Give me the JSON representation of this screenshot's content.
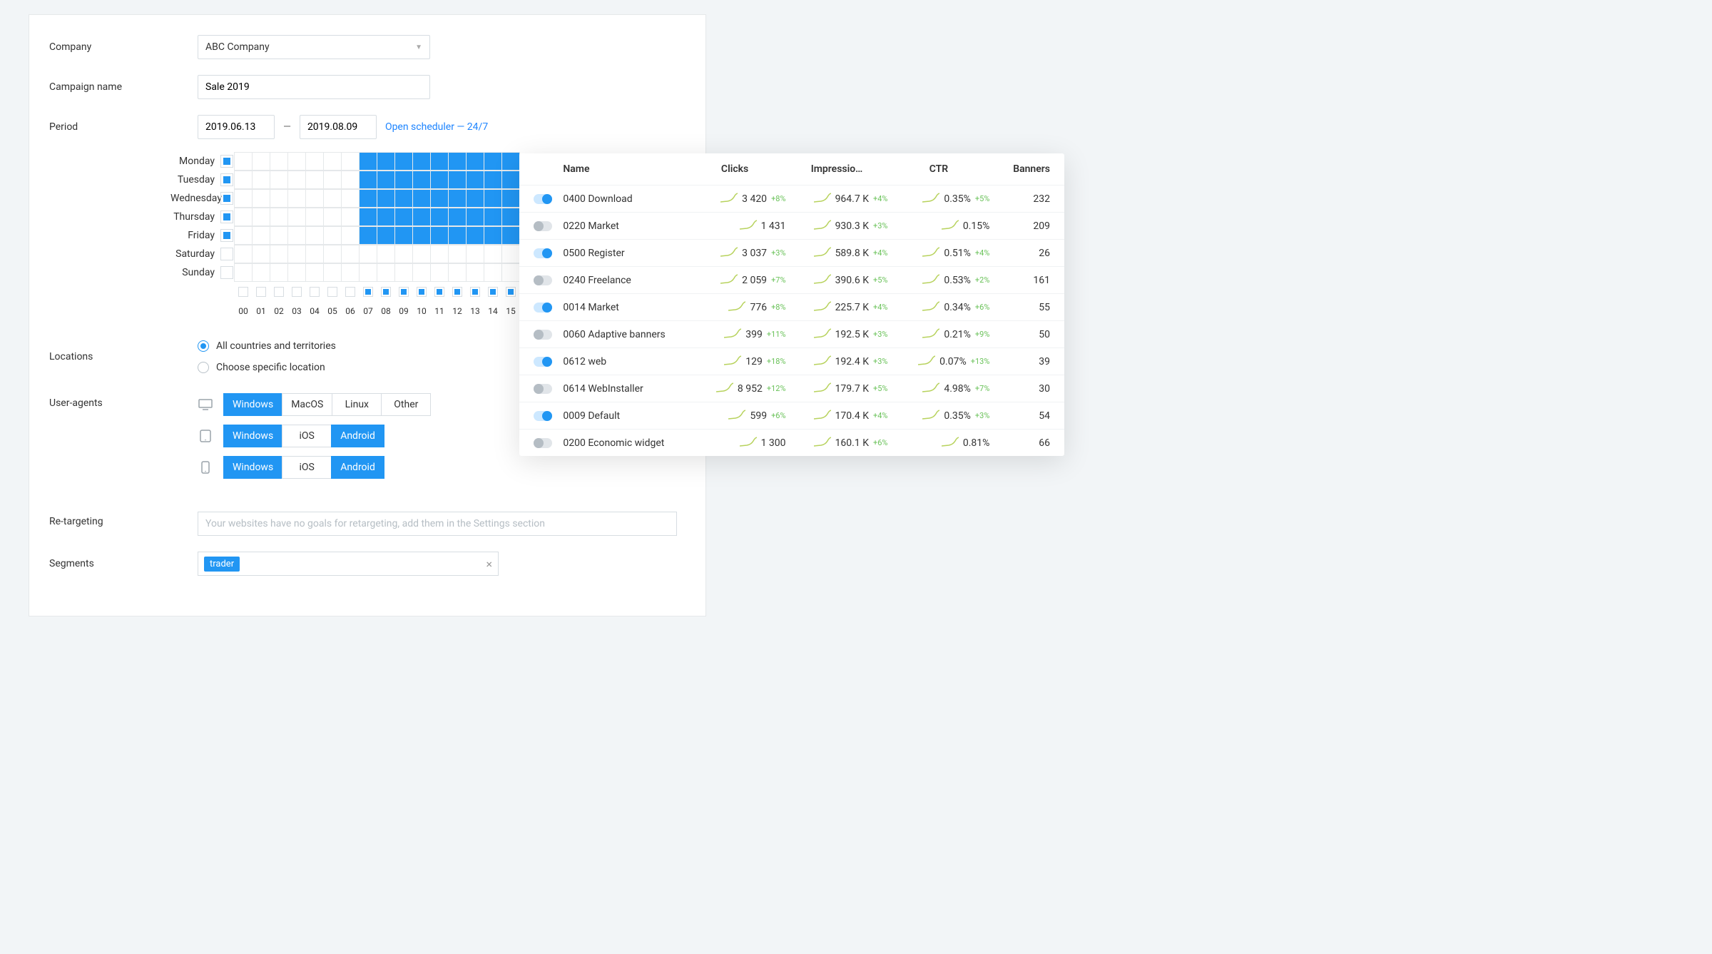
{
  "form": {
    "company_label": "Company",
    "company_value": "ABC Company",
    "campaign_label": "Campaign name",
    "campaign_value": "Sale 2019",
    "period_label": "Period",
    "period_from": "2019.06.13",
    "period_to": "2019.08.09",
    "scheduler_link": "Open scheduler — 24/7",
    "dash": "—"
  },
  "scheduler": {
    "days": [
      {
        "label": "Monday",
        "checked": true
      },
      {
        "label": "Tuesday",
        "checked": true
      },
      {
        "label": "Wednesday",
        "checked": true
      },
      {
        "label": "Thursday",
        "checked": true
      },
      {
        "label": "Friday",
        "checked": true
      },
      {
        "label": "Saturday",
        "checked": false
      },
      {
        "label": "Sunday",
        "checked": false
      }
    ],
    "hours": [
      "00",
      "01",
      "02",
      "03",
      "04",
      "05",
      "06",
      "07",
      "08",
      "09",
      "10",
      "11",
      "12",
      "13",
      "14",
      "15"
    ],
    "hour_checked_from": 7,
    "fill_day_from": 0,
    "fill_day_to": 4,
    "fill_hour_from": 7,
    "fill_hour_to": 15
  },
  "locations": {
    "label": "Locations",
    "options": [
      {
        "label": "All countries and territories",
        "selected": true
      },
      {
        "label": "Choose specific location",
        "selected": false
      }
    ]
  },
  "useragents": {
    "label": "User-agents",
    "rows": [
      {
        "device": "desktop",
        "opts": [
          {
            "label": "Windows",
            "on": true
          },
          {
            "label": "MacOS",
            "on": false
          },
          {
            "label": "Linux",
            "on": false
          },
          {
            "label": "Other",
            "on": false
          }
        ]
      },
      {
        "device": "tablet",
        "opts": [
          {
            "label": "Windows",
            "on": true
          },
          {
            "label": "iOS",
            "on": false
          },
          {
            "label": "Android",
            "on": true
          }
        ]
      },
      {
        "device": "mobile",
        "opts": [
          {
            "label": "Windows",
            "on": true
          },
          {
            "label": "iOS",
            "on": false
          },
          {
            "label": "Android",
            "on": true
          }
        ]
      }
    ]
  },
  "retarget": {
    "label": "Re-targeting",
    "placeholder": "Your websites have no goals for retargeting, add them in the Settings section"
  },
  "segments": {
    "label": "Segments",
    "tags": [
      "trader"
    ]
  },
  "stats": {
    "headers": [
      "Name",
      "Clicks",
      "Impressio…",
      "CTR",
      "Banners"
    ],
    "rows": [
      {
        "on": true,
        "name": "0400 Download",
        "clicks": "3 420",
        "clicks_d": "+8%",
        "impr": "964.7 K",
        "impr_d": "+4%",
        "ctr": "0.35%",
        "ctr_d": "+5%",
        "banners": "232"
      },
      {
        "on": false,
        "name": "0220 Market",
        "clicks": "1 431",
        "clicks_d": "",
        "impr": "930.3 K",
        "impr_d": "+3%",
        "ctr": "0.15%",
        "ctr_d": "",
        "banners": "209"
      },
      {
        "on": true,
        "name": "0500 Register",
        "clicks": "3 037",
        "clicks_d": "+3%",
        "impr": "589.8 K",
        "impr_d": "+4%",
        "ctr": "0.51%",
        "ctr_d": "+4%",
        "banners": "26"
      },
      {
        "on": false,
        "name": "0240 Freelance",
        "clicks": "2 059",
        "clicks_d": "+7%",
        "impr": "390.6 K",
        "impr_d": "+5%",
        "ctr": "0.53%",
        "ctr_d": "+2%",
        "banners": "161"
      },
      {
        "on": true,
        "name": "0014 Market",
        "clicks": "776",
        "clicks_d": "+8%",
        "impr": "225.7 K",
        "impr_d": "+4%",
        "ctr": "0.34%",
        "ctr_d": "+6%",
        "banners": "55"
      },
      {
        "on": false,
        "name": "0060 Adaptive banners",
        "clicks": "399",
        "clicks_d": "+11%",
        "impr": "192.5 K",
        "impr_d": "+3%",
        "ctr": "0.21%",
        "ctr_d": "+9%",
        "banners": "50"
      },
      {
        "on": true,
        "name": "0612 web",
        "clicks": "129",
        "clicks_d": "+18%",
        "impr": "192.4 K",
        "impr_d": "+3%",
        "ctr": "0.07%",
        "ctr_d": "+13%",
        "banners": "39"
      },
      {
        "on": false,
        "name": "0614 WebInstaller",
        "clicks": "8 952",
        "clicks_d": "+12%",
        "impr": "179.7 K",
        "impr_d": "+5%",
        "ctr": "4.98%",
        "ctr_d": "+7%",
        "banners": "30"
      },
      {
        "on": true,
        "name": "0009 Default",
        "clicks": "599",
        "clicks_d": "+6%",
        "impr": "170.4 K",
        "impr_d": "+4%",
        "ctr": "0.35%",
        "ctr_d": "+3%",
        "banners": "54"
      },
      {
        "on": false,
        "name": "0200 Economic widget",
        "clicks": "1 300",
        "clicks_d": "",
        "impr": "160.1 K",
        "impr_d": "+6%",
        "ctr": "0.81%",
        "ctr_d": "",
        "banners": "66"
      }
    ]
  }
}
